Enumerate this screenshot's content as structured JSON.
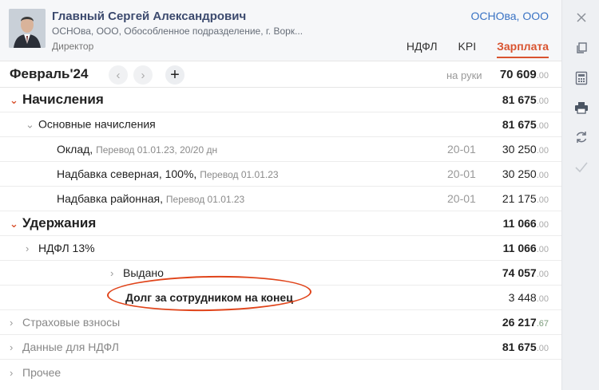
{
  "employee": {
    "name": "Главный Сергей Александрович",
    "org_line": "ОСНОва, ООО, Обособленное подразделение, г. Ворк...",
    "position": "Директор",
    "org_link": "ОСНОва, ООО"
  },
  "tabs": [
    {
      "label": "НДФЛ",
      "active": false
    },
    {
      "label": "KPI",
      "active": false
    },
    {
      "label": "Зарплата",
      "active": true
    }
  ],
  "period": {
    "title": "Февраль'24",
    "prev_icon": "chevron-left-icon",
    "next_icon": "chevron-right-icon",
    "add_icon": "plus-icon",
    "net_label": "на руки",
    "net_value": "70 609",
    "net_dec": ".00"
  },
  "rows": {
    "accruals": {
      "label": "Начисления",
      "value": "81 675",
      "dec": ".00",
      "expanded": true
    },
    "basic": {
      "label": "Основные начисления",
      "value": "81 675",
      "dec": ".00",
      "expanded": true
    },
    "salary": {
      "label": "Оклад,",
      "sub": "Перевод 01.01.23, 20/20 дн",
      "acc": "20-01",
      "value": "30 250",
      "dec": ".00"
    },
    "northern": {
      "label": "Надбавка северная, 100%,",
      "sub": "Перевод 01.01.23",
      "acc": "20-01",
      "value": "30 250",
      "dec": ".00"
    },
    "regional": {
      "label": "Надбавка районная,",
      "sub": "Перевод 01.01.23",
      "acc": "20-01",
      "value": "21 175",
      "dec": ".00"
    },
    "deductions": {
      "label": "Удержания",
      "value": "11 066",
      "dec": ".00",
      "expanded": true
    },
    "ndfl": {
      "label": "НДФЛ 13%",
      "value": "11 066",
      "dec": ".00",
      "expanded": false
    },
    "paid": {
      "label": "Выдано",
      "value": "74 057",
      "dec": ".00",
      "expanded": false
    },
    "debt": {
      "label": "Долг за сотрудником на конец",
      "value": "3 448",
      "dec": ".00"
    },
    "insurance": {
      "label": "Страховые взносы",
      "value": "26 217",
      "dec": ".67",
      "expanded": false
    },
    "ndfl_data": {
      "label": "Данные для НДФЛ",
      "value": "81 675",
      "dec": ".00",
      "expanded": false
    },
    "other": {
      "label": "Прочее",
      "expanded": false
    }
  },
  "toolbar": {
    "icons": [
      "close-icon",
      "copy-icon",
      "calculator-icon",
      "print-icon",
      "refresh-icon",
      "check-icon"
    ]
  },
  "colors": {
    "accent": "#d9532f",
    "link": "#3a73c4",
    "highlight_ellipse": "#e0441a"
  }
}
